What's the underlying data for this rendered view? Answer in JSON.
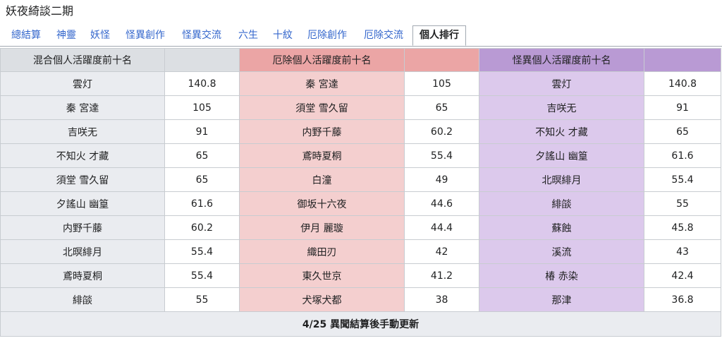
{
  "page_title": "妖夜綺談二期",
  "tabs": [
    {
      "label": "總結算"
    },
    {
      "label": "神靈"
    },
    {
      "label": "妖怪"
    },
    {
      "label": "怪異創作"
    },
    {
      "label": "怪異交流"
    },
    {
      "label": "六生"
    },
    {
      "label": "十紋"
    },
    {
      "label": "厄除創作"
    },
    {
      "label": "厄除交流"
    },
    {
      "label": "個人排行"
    }
  ],
  "active_tab": "個人排行",
  "table": {
    "headers": {
      "mixed": "混合個人活躍度前十名",
      "yakuyoke": "厄除個人活躍度前十名",
      "kaii": "怪異個人活躍度前十名"
    },
    "rows": [
      {
        "mixed_name": "雲灯",
        "mixed_score": "140.8",
        "yaku_name": "秦 宮達",
        "yaku_score": "105",
        "kaii_name": "雲灯",
        "kaii_score": "140.8"
      },
      {
        "mixed_name": "秦 宮達",
        "mixed_score": "105",
        "yaku_name": "須堂 雪久留",
        "yaku_score": "65",
        "kaii_name": "吉咲无",
        "kaii_score": "91"
      },
      {
        "mixed_name": "吉咲无",
        "mixed_score": "91",
        "yaku_name": "内野千藤",
        "yaku_score": "60.2",
        "kaii_name": "不知火 才藏",
        "kaii_score": "65"
      },
      {
        "mixed_name": "不知火 才藏",
        "mixed_score": "65",
        "yaku_name": "鳶時夏桐",
        "yaku_score": "55.4",
        "kaii_name": "夕謠山 幽篁",
        "kaii_score": "61.6"
      },
      {
        "mixed_name": "須堂 雪久留",
        "mixed_score": "65",
        "yaku_name": "白潼",
        "yaku_score": "49",
        "kaii_name": "北暝緋月",
        "kaii_score": "55.4"
      },
      {
        "mixed_name": "夕謠山 幽篁",
        "mixed_score": "61.6",
        "yaku_name": "御坂十六夜",
        "yaku_score": "44.6",
        "kaii_name": "緋燄",
        "kaii_score": "55"
      },
      {
        "mixed_name": "内野千藤",
        "mixed_score": "60.2",
        "yaku_name": "伊月 麗璇",
        "yaku_score": "44.4",
        "kaii_name": "蘇蝕",
        "kaii_score": "45.8"
      },
      {
        "mixed_name": "北暝緋月",
        "mixed_score": "55.4",
        "yaku_name": "織田刃",
        "yaku_score": "42",
        "kaii_name": "溪流",
        "kaii_score": "43"
      },
      {
        "mixed_name": "鳶時夏桐",
        "mixed_score": "55.4",
        "yaku_name": "東久世京",
        "yaku_score": "41.2",
        "kaii_name": "椿 赤染",
        "kaii_score": "42.4"
      },
      {
        "mixed_name": "緋燄",
        "mixed_score": "55",
        "yaku_name": "犬塚犬都",
        "yaku_score": "38",
        "kaii_name": "那津",
        "kaii_score": "36.8"
      }
    ],
    "footer": "4/25 異聞結算後手動更新"
  },
  "colors": {
    "mixed_header": "#dcdfe3",
    "mixed_cell": "#eaecf0",
    "yakuyoke_header": "#eba5a5",
    "yakuyoke_cell": "#f4cfcf",
    "kaii_header": "#b99ad4",
    "kaii_cell": "#dcc9ec",
    "link": "#3366cc"
  }
}
